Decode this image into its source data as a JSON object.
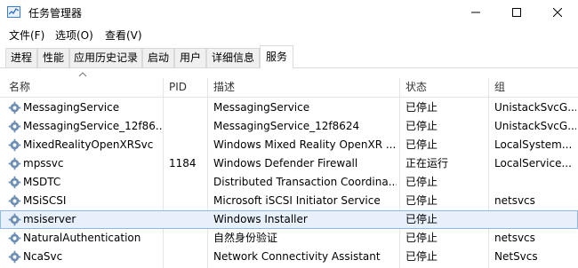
{
  "window": {
    "title": "任务管理器"
  },
  "menu": [
    "文件(F)",
    "选项(O)",
    "查看(V)"
  ],
  "tabs": [
    "进程",
    "性能",
    "应用历史记录",
    "启动",
    "用户",
    "详细信息",
    "服务"
  ],
  "active_tab": 6,
  "columns": [
    "名称",
    "PID",
    "描述",
    "状态",
    "组"
  ],
  "rows": [
    {
      "name": "MessagingService",
      "pid": "",
      "desc": "MessagingService",
      "status": "已停止",
      "group": "UnistackSvcG..."
    },
    {
      "name": "MessagingService_12f86...",
      "pid": "",
      "desc": "MessagingService_12f8624",
      "status": "已停止",
      "group": "UnistackSvcG..."
    },
    {
      "name": "MixedRealityOpenXRSvc",
      "pid": "",
      "desc": "Windows Mixed Reality OpenXR ...",
      "status": "已停止",
      "group": "LocalSystem..."
    },
    {
      "name": "mpssvc",
      "pid": "1184",
      "desc": "Windows Defender Firewall",
      "status": "正在运行",
      "group": "LocalService..."
    },
    {
      "name": "MSDTC",
      "pid": "",
      "desc": "Distributed Transaction Coordina...",
      "status": "已停止",
      "group": ""
    },
    {
      "name": "MSiSCSI",
      "pid": "",
      "desc": "Microsoft iSCSI Initiator Service",
      "status": "已停止",
      "group": "netsvcs"
    },
    {
      "name": "msiserver",
      "pid": "",
      "desc": "Windows Installer",
      "status": "已停止",
      "group": ""
    },
    {
      "name": "NaturalAuthentication",
      "pid": "",
      "desc": "自然身份验证",
      "status": "已停止",
      "group": "netsvcs"
    },
    {
      "name": "NcaSvc",
      "pid": "",
      "desc": "Network Connectivity Assistant",
      "status": "已停止",
      "group": "NetSvcs"
    }
  ],
  "selected_row": 6,
  "colors": {
    "selection_bg": "#e8f0fb",
    "selection_border": "#8fb8e8",
    "accent": "#3a7bd5"
  }
}
